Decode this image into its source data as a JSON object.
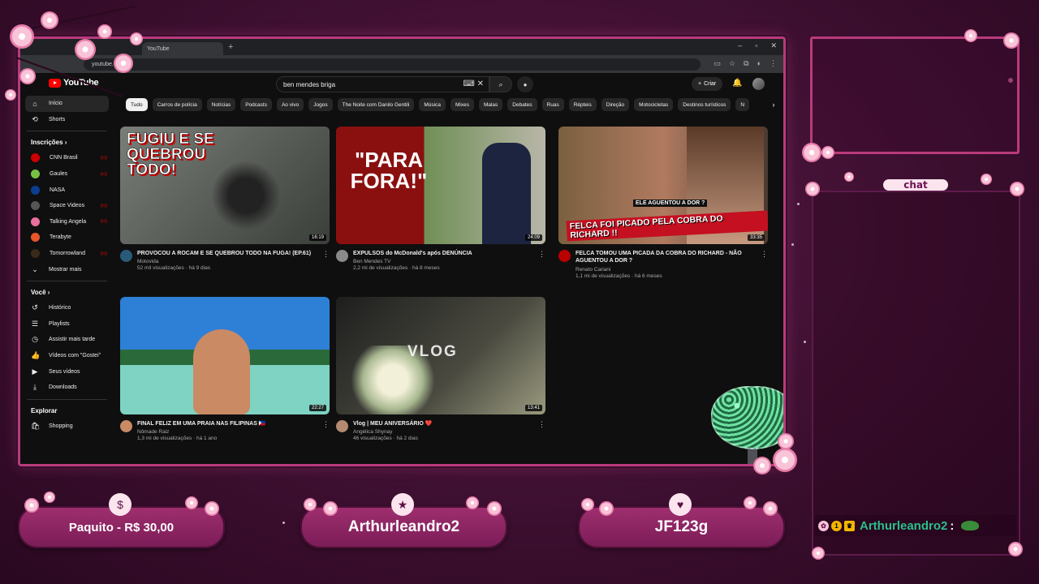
{
  "browser": {
    "tab_title": "YouTube",
    "new_tab_icon": "+",
    "url": "youtube.com",
    "window_controls": [
      "–",
      "▫",
      "✕"
    ]
  },
  "youtube": {
    "logo": "YouTube",
    "search_value": "ben mendes briga",
    "create_label": "Criar",
    "sidebar": {
      "main": [
        {
          "label": "Início",
          "icon": "home-icon",
          "active": true
        },
        {
          "label": "Shorts",
          "icon": "shorts-icon"
        }
      ],
      "subscriptions_header": "Inscrições",
      "subscriptions": [
        {
          "label": "CNN Brasil",
          "color": "#cc0000"
        },
        {
          "label": "Gaules",
          "color": "#7ac143"
        },
        {
          "label": "NASA",
          "color": "#0b3d91"
        },
        {
          "label": "Space Videos",
          "color": "#555555"
        },
        {
          "label": "Talking Angela",
          "color": "#e86fa0"
        },
        {
          "label": "Terabyte",
          "color": "#e8572a"
        },
        {
          "label": "Tomorrowland",
          "color": "#3a2a1a"
        }
      ],
      "show_more": "Mostrar mais",
      "you_header": "Você",
      "you_items": [
        {
          "label": "Histórico",
          "icon": "history-icon"
        },
        {
          "label": "Playlists",
          "icon": "playlists-icon"
        },
        {
          "label": "Assistir mais tarde",
          "icon": "watch-later-icon"
        },
        {
          "label": "Vídeos com \"Gostei\"",
          "icon": "like-icon"
        },
        {
          "label": "Seus vídeos",
          "icon": "your-videos-icon"
        },
        {
          "label": "Downloads",
          "icon": "download-icon"
        }
      ],
      "explore_header": "Explorar",
      "explore_items": [
        {
          "label": "Shopping",
          "icon": "shopping-icon"
        }
      ]
    },
    "chips": [
      "Tudo",
      "Carros de polícia",
      "Notícias",
      "Podcasts",
      "Ao vivo",
      "Jogos",
      "The Noite com Danilo Gentili",
      "Música",
      "Mixes",
      "Malas",
      "Debates",
      "Ruas",
      "Répteis",
      "Direção",
      "Motocicletas",
      "Destinos turísticos",
      "N"
    ],
    "videos": [
      {
        "title": "PROVOCOU A ROCAM E SE QUEBROU TODO NA FUGA! (EP.61)",
        "channel": "Motovida",
        "stats": "52 mil visualizações · há 9 dias",
        "duration": "16:19",
        "thumb_text": "FUGIU E SE QUEBROU TODO!",
        "thumb_colors": [
          "#6b6f6b",
          "#3b3f3a"
        ]
      },
      {
        "title": "EXPULSOS do McDonald's após DENÚNCIA",
        "channel": "Ben Mendes TV",
        "stats": "2,2 mi de visualizações · há 8 meses",
        "duration": "24:09",
        "thumb_text": "\"PARA FORA!\"",
        "thumb_colors": [
          "#8a1010",
          "#5d8a45"
        ]
      },
      {
        "title": "FELCA TOMOU UMA PICADA DA COBRA DO RICHARD - NÃO AGUENTOU A DOR ?",
        "channel": "Renato Cariani",
        "stats": "1,1 mi de visualizações · há 6 meses",
        "duration": "33:35",
        "thumb_text": "FELCA FOI PICADO PELA COBRA DO RICHARD !!",
        "thumb_subtext": "ELE AGUENTOU A DOR ?",
        "thumb_colors": [
          "#7a6040",
          "#3a2a20"
        ]
      },
      {
        "title": "FINAL FELIZ EM UMA PRAIA NAS FILIPINAS 🇵🇭",
        "channel": "Nômade Raiz",
        "stats": "1,3 mi de visualizações · há 1 ano",
        "duration": "22:27",
        "thumb_text": "",
        "thumb_colors": [
          "#3a8fd8",
          "#7fd3c2"
        ]
      },
      {
        "title": "Vlog | MEU ANIVERSÁRIO ❤️",
        "channel": "Angélica Shynay",
        "stats": "46 visualizações · há 2 dias",
        "duration": "13:41",
        "thumb_text": "VLOG",
        "thumb_colors": [
          "#2a2a2a",
          "#8a8a70"
        ]
      }
    ]
  },
  "overlay": {
    "chat_title": "chat",
    "chat_message": {
      "user": "Arthurleandro2",
      "separator": ":",
      "badges": [
        "flower-badge",
        "1",
        "crown-badge"
      ]
    },
    "donor_label": "Paquito - R$ 30,00",
    "follower_label": "Arthurleandro2",
    "subscriber_label": "JF123g",
    "accent_color": "#b93a7c",
    "donor_icon": "$",
    "follower_icon": "★",
    "subscriber_icon": "♥"
  }
}
